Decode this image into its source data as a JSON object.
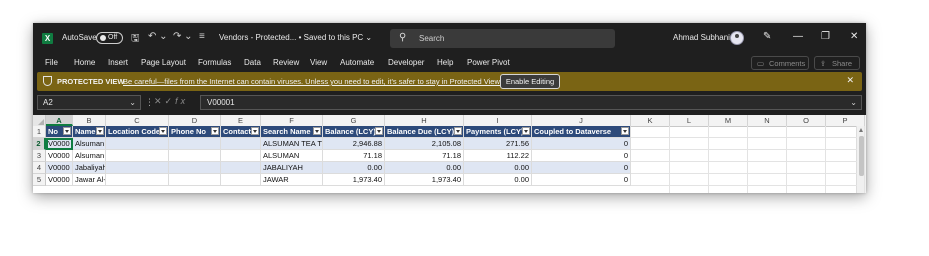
{
  "titlebar": {
    "autosave_label": "AutoSave",
    "autosave_state": "Off",
    "document_title": "Vendors  -  Protected...  •  Saved to this PC ⌄",
    "search_placeholder": "Search",
    "user_name": "Ahmad Subhani",
    "icons": [
      "excel-logo-icon",
      "save-icon",
      "undo-icon",
      "redo-icon",
      "customize-qat-icon",
      "search-icon",
      "pen-icon",
      "minimize-icon",
      "restore-icon",
      "close-icon"
    ]
  },
  "menu": {
    "items": [
      "File",
      "Home",
      "Insert",
      "Page Layout",
      "Formulas",
      "Data",
      "Review",
      "View",
      "Automate",
      "Developer",
      "Help",
      "Power Pivot"
    ],
    "comments_label": "Comments",
    "share_label": "Share"
  },
  "protected_view": {
    "title": "PROTECTED VIEW",
    "message": "Be careful—files from the Internet can contain viruses. Unless you need to edit, it's safer to stay in Protected View.",
    "button": "Enable Editing",
    "bg_color": "#7a6414"
  },
  "formula_bar": {
    "name_box": "A2",
    "fx_label": "fx",
    "formula": "V00001"
  },
  "sheet": {
    "columns": [
      "A",
      "B",
      "C",
      "D",
      "E",
      "F",
      "G",
      "H",
      "I",
      "J",
      "K",
      "L",
      "M",
      "N",
      "O",
      "P"
    ],
    "selected_column": "A",
    "row_numbers": [
      "1",
      "2",
      "3",
      "4",
      "5"
    ],
    "selected_row": "2",
    "headers": [
      "No",
      "Name",
      "Location Code",
      "Phone No",
      "Contact",
      "Search Name",
      "Balance (LCY)",
      "Balance Due (LCY)",
      "Payments (LCY)",
      "Coupled to Dataverse"
    ],
    "rows": [
      [
        "V0000",
        "Alsuman",
        "",
        "",
        "",
        "ALSUMAN TEA T",
        "2,946.88",
        "2,105.08",
        "271.56",
        "0"
      ],
      [
        "V0000",
        "Alsuman",
        "",
        "",
        "",
        "ALSUMAN",
        "71.18",
        "71.18",
        "112.22",
        "0"
      ],
      [
        "V0000",
        "Jabaliyah",
        "",
        "",
        "",
        "JABALIYAH",
        "0.00",
        "0.00",
        "0.00",
        "0"
      ],
      [
        "V0000",
        "Jawar Al-",
        "",
        "",
        "",
        "JAWAR",
        "1,973.40",
        "1,973.40",
        "0.00",
        "0"
      ]
    ],
    "header_color": "#2d4a7a",
    "band_color": "#dfe6f3"
  }
}
